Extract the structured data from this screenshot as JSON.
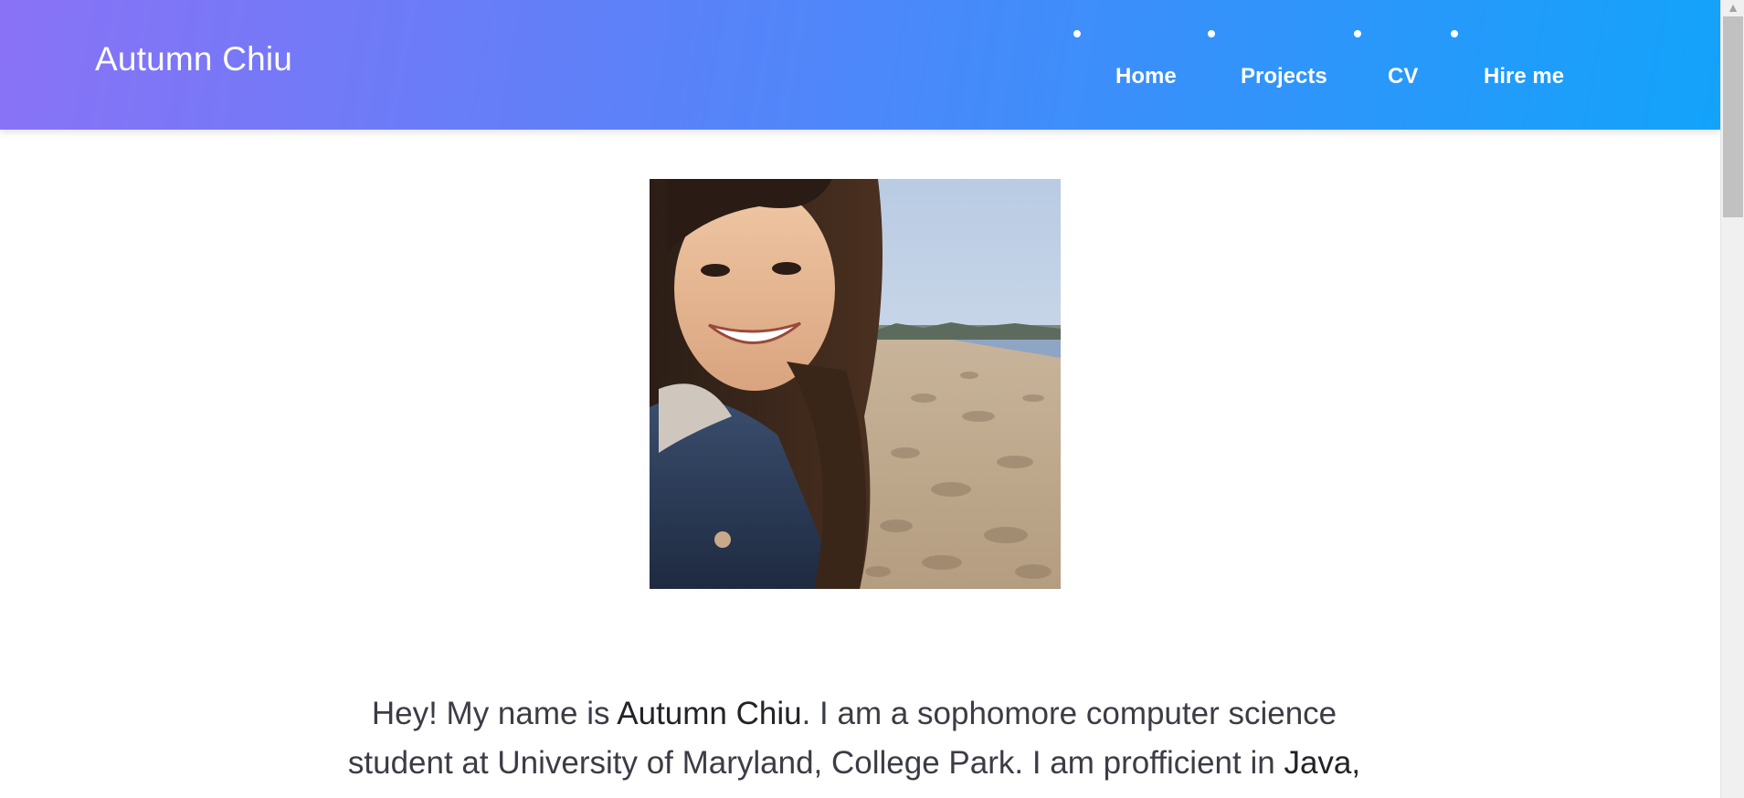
{
  "navbar": {
    "brand": "Autumn Chiu",
    "items": [
      {
        "label": "Home"
      },
      {
        "label": "Projects"
      },
      {
        "label": "CV"
      },
      {
        "label": "Hire me"
      }
    ]
  },
  "main": {
    "photo": {
      "alt": "Autumn Chiu"
    },
    "bio": {
      "intro": "Hey! My name is ",
      "name": "Autumn Chiu",
      "middle": ". I am a sophomore computer science student at University of Maryland, College Park. I am profficient in ",
      "skills": "Java, Python, HTML/CSS and Javasrcipt."
    }
  },
  "scrollbar": {
    "up_icon": "▲"
  }
}
